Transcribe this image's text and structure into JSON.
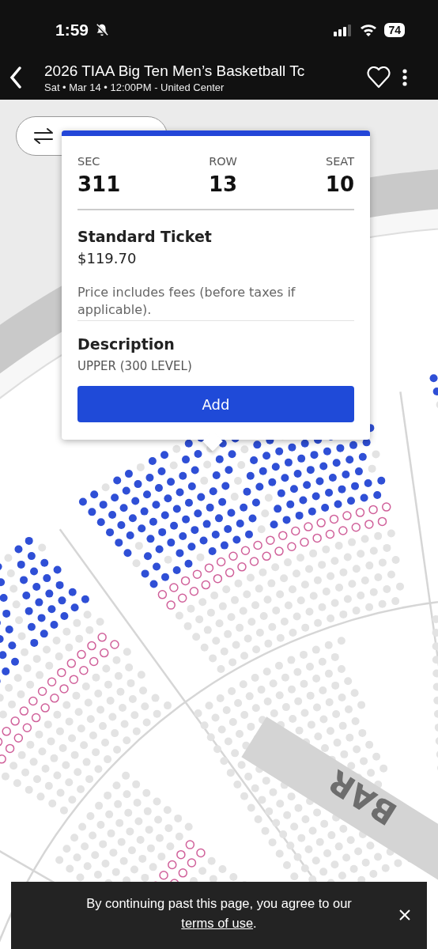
{
  "status_bar": {
    "time": "1:59",
    "battery": "74"
  },
  "header": {
    "title": "2026 TIAA Big Ten Men’s Basketball Tc",
    "subtitle": "Sat • Mar 14 • 12:00PM - United Center"
  },
  "map": {
    "bar_label": "BAR"
  },
  "ticket_popup": {
    "fields": [
      {
        "label": "SEC",
        "value": "311"
      },
      {
        "label": "ROW",
        "value": "13"
      },
      {
        "label": "SEAT",
        "value": "10"
      }
    ],
    "ticket_type": "Standard Ticket",
    "price": "$119.70",
    "price_note": "Price includes fees (before taxes if applicable).",
    "description_title": "Description",
    "description": "UPPER (300 LEVEL)",
    "add_button": "Add"
  },
  "consent_banner": {
    "text": "By continuing past this page, you agree to our ",
    "link": "terms of use",
    "text_after": "."
  }
}
